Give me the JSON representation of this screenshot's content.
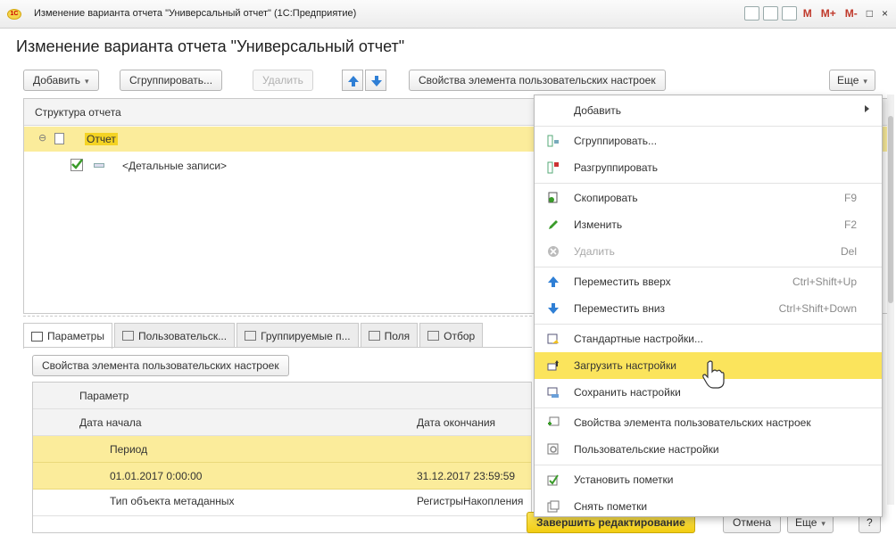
{
  "window": {
    "title": "Изменение варианта отчета \"Универсальный отчет\"  (1С:Предприятие)",
    "logo": "1С"
  },
  "title_bar_icons": {
    "m": "M",
    "m_plus": "M+",
    "m_minus": "M-",
    "restore": "□",
    "close": "×"
  },
  "form": {
    "title": "Изменение варианта отчета \"Универсальный отчет\""
  },
  "toolbar": {
    "add": "Добавить",
    "group": "Сгруппировать...",
    "delete": "Удалить",
    "props": "Свойства элемента пользовательских настроек",
    "more": "Еще"
  },
  "tree": {
    "header": "Структура отчета",
    "rows": [
      {
        "label": "Отчет"
      },
      {
        "label": "<Детальные записи>"
      }
    ]
  },
  "tabs": [
    {
      "label": "Параметры",
      "icon": "table-icon"
    },
    {
      "label": "Пользовательск...",
      "icon": "custom-fields-icon"
    },
    {
      "label": "Группируемые п...",
      "icon": "grouping-icon"
    },
    {
      "label": "Поля",
      "icon": "fields-icon"
    },
    {
      "label": "Отбор",
      "icon": "filter-icon"
    }
  ],
  "params_panel": {
    "props_button": "Свойства элемента пользовательских настроек",
    "col_header": "Параметр",
    "row_start": "Дата начала",
    "row_end": "Дата окончания",
    "period": "Период",
    "start_value": "01.01.2017 0:00:00",
    "end_value": "31.12.2017 23:59:59",
    "next_row_left": "Тип объекта метаданных",
    "next_row_right": "РегистрыНакопления"
  },
  "footer": {
    "finish": "Завершить редактирование",
    "cancel": "Отмена",
    "more": "Еще",
    "help": "?"
  },
  "menu": {
    "items": [
      {
        "label": "Добавить",
        "shortcut": "",
        "icon": "",
        "submenu": true
      },
      {
        "label": "Сгруппировать...",
        "shortcut": "",
        "icon": "group-icon"
      },
      {
        "label": "Разгруппировать",
        "shortcut": "",
        "icon": "ungroup-icon"
      },
      {
        "label": "Скопировать",
        "shortcut": "F9",
        "icon": "copy-icon"
      },
      {
        "label": "Изменить",
        "shortcut": "F2",
        "icon": "pencil-icon"
      },
      {
        "label": "Удалить",
        "shortcut": "Del",
        "icon": "delete-icon",
        "disabled": true
      },
      {
        "label": "Переместить вверх",
        "shortcut": "Ctrl+Shift+Up",
        "icon": "arrow-up-icon"
      },
      {
        "label": "Переместить вниз",
        "shortcut": "Ctrl+Shift+Down",
        "icon": "arrow-down-icon"
      },
      {
        "label": "Стандартные настройки...",
        "shortcut": "",
        "icon": "standard-settings-icon"
      },
      {
        "label": "Загрузить настройки",
        "shortcut": "",
        "icon": "load-settings-icon",
        "highlighted": true
      },
      {
        "label": "Сохранить настройки",
        "shortcut": "",
        "icon": "save-settings-icon"
      },
      {
        "label": "Свойства элемента пользовательских настроек",
        "shortcut": "",
        "icon": "element-props-icon"
      },
      {
        "label": "Пользовательские настройки",
        "shortcut": "",
        "icon": "user-settings-icon"
      },
      {
        "label": "Установить пометки",
        "shortcut": "",
        "icon": "check-all-icon"
      },
      {
        "label": "Снять пометки",
        "shortcut": "",
        "icon": "uncheck-all-icon"
      }
    ]
  },
  "colors": {
    "accent_yellow": "#fbe45c",
    "selection": "#fbec9b",
    "green_check": "#3a9b2a"
  }
}
